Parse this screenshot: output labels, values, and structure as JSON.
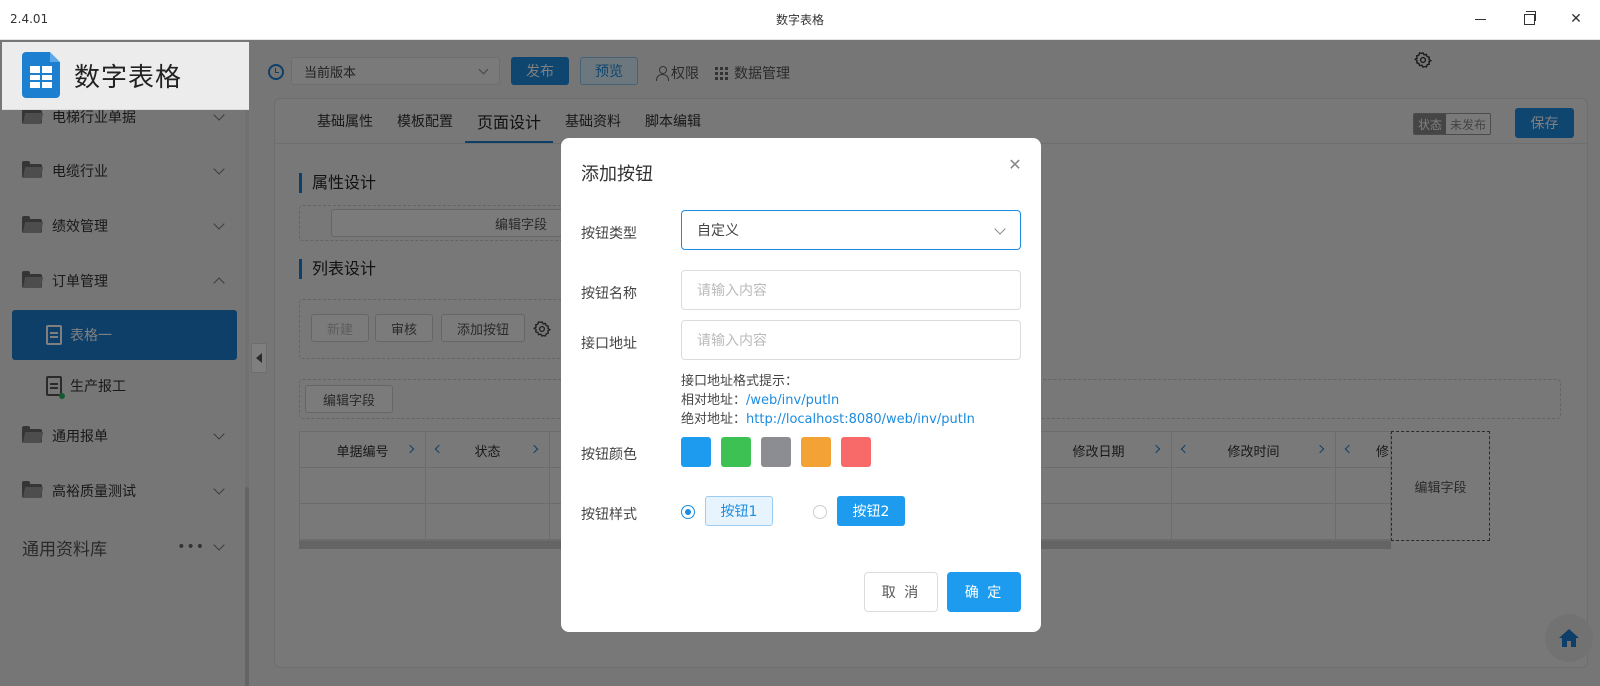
{
  "window": {
    "version": "2.4.01",
    "title": "数字表格"
  },
  "sidebar": {
    "app_name": "数字表格",
    "items": [
      {
        "label": "电梯行业单据"
      },
      {
        "label": "电缆行业"
      },
      {
        "label": "绩效管理"
      },
      {
        "label": "订单管理"
      },
      {
        "label": "表格一"
      },
      {
        "label": "生产报工"
      },
      {
        "label": "通用报单"
      },
      {
        "label": "高裕质量测试"
      }
    ],
    "library_label": "通用资料库",
    "library_more": "•••"
  },
  "toolbar": {
    "version_select": "当前版本",
    "publish": "发布",
    "preview": "预览",
    "permission": "权限",
    "data_management": "数据管理"
  },
  "tabs": [
    {
      "label": "基础属性"
    },
    {
      "label": "模板配置"
    },
    {
      "label": "页面设计"
    },
    {
      "label": "基础资料"
    },
    {
      "label": "脚本编辑"
    }
  ],
  "status": {
    "key": "状态",
    "value": "未发布"
  },
  "save": "保存",
  "sections": {
    "property_design": "属性设计",
    "list_design": "列表设计",
    "edit_field": "编辑字段"
  },
  "list_buttons": {
    "new": "新建",
    "audit": "审核",
    "add_button": "添加按钮"
  },
  "table": {
    "headers": [
      "单据编号",
      "状态",
      "修改日期",
      "修改时间",
      "修"
    ],
    "edit_field": "编辑字段"
  },
  "modal": {
    "title": "添加按钮",
    "type_label": "按钮类型",
    "type_value": "自定义",
    "name_label": "按钮名称",
    "name_placeholder": "请输入内容",
    "url_label": "接口地址",
    "url_placeholder": "请输入内容",
    "hint_title": "接口地址格式提示：",
    "hint_relative_label": "相对地址：",
    "hint_relative_value": "/web/inv/putIn",
    "hint_absolute_label": "绝对地址：",
    "hint_absolute_value": "http://localhost:8080/web/inv/putIn",
    "color_label": "按钮颜色",
    "colors": [
      "#1c9bef",
      "#3cc152",
      "#8c8d93",
      "#f3a236",
      "#f86a6a"
    ],
    "style_label": "按钮样式",
    "style1": "按钮1",
    "style2": "按钮2",
    "cancel": "取 消",
    "confirm": "确 定"
  }
}
